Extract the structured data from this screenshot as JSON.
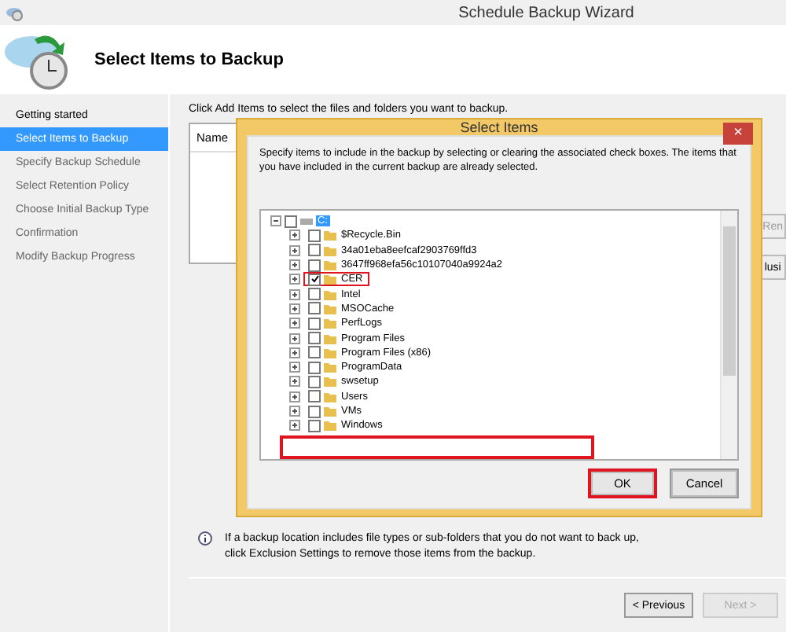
{
  "window": {
    "title": "Schedule Backup Wizard"
  },
  "header": {
    "title": "Select Items to Backup"
  },
  "sidebar": {
    "items": [
      {
        "label": "Getting started",
        "selected": false,
        "disabled": false
      },
      {
        "label": "Select Items to Backup",
        "selected": true,
        "disabled": false
      },
      {
        "label": "Specify Backup Schedule",
        "selected": false,
        "disabled": true
      },
      {
        "label": "Select Retention Policy",
        "selected": false,
        "disabled": true
      },
      {
        "label": "Choose Initial Backup Type",
        "selected": false,
        "disabled": true
      },
      {
        "label": "Confirmation",
        "selected": false,
        "disabled": true
      },
      {
        "label": "Modify Backup Progress",
        "selected": false,
        "disabled": true
      }
    ]
  },
  "content": {
    "instruction": "Click Add Items to select the files and folders you want to backup.",
    "table": {
      "columns": [
        "Name"
      ]
    },
    "side_buttons": [
      "Ren",
      "lusi"
    ],
    "info": "If a backup location includes file types or sub-folders that you do not want to back up, click Exclusion Settings to remove those items from the backup."
  },
  "dialog": {
    "title": "Select Items",
    "close": "×",
    "description": "Specify items to include in the backup by selecting or clearing the associated check boxes. The items that you have included in the current backup are already selected.",
    "tree": {
      "label": "C:",
      "checked": false,
      "expanded": true,
      "selected": true,
      "children": [
        {
          "label": "$Recycle.Bin",
          "checked": false,
          "highlighted": false
        },
        {
          "label": "34a01eba8eefcaf2903769ffd3",
          "checked": false,
          "highlighted": false
        },
        {
          "label": "3647ff968efa56c10107040a9924a2",
          "checked": false,
          "highlighted": false
        },
        {
          "label": "CER",
          "checked": true,
          "highlighted": true
        },
        {
          "label": "Intel",
          "checked": false,
          "highlighted": false
        },
        {
          "label": "MSOCache",
          "checked": false,
          "highlighted": false
        },
        {
          "label": "PerfLogs",
          "checked": false,
          "highlighted": false
        },
        {
          "label": "Program Files",
          "checked": false,
          "highlighted": false
        },
        {
          "label": "Program Files (x86)",
          "checked": false,
          "highlighted": false
        },
        {
          "label": "ProgramData",
          "checked": false,
          "highlighted": false
        },
        {
          "label": "swsetup",
          "checked": false,
          "highlighted": false
        },
        {
          "label": "Users",
          "checked": false,
          "highlighted": false
        },
        {
          "label": "VMs",
          "checked": false,
          "highlighted": false
        },
        {
          "label": "Windows",
          "checked": false,
          "highlighted": false
        }
      ]
    },
    "redaction_box": true,
    "buttons": [
      {
        "label": "OK",
        "highlighted": true
      },
      {
        "label": "Cancel",
        "highlighted": false
      }
    ]
  },
  "footer": {
    "buttons": [
      {
        "label": "< Previous",
        "disabled": false
      },
      {
        "label": "Next >",
        "disabled": true
      }
    ]
  }
}
